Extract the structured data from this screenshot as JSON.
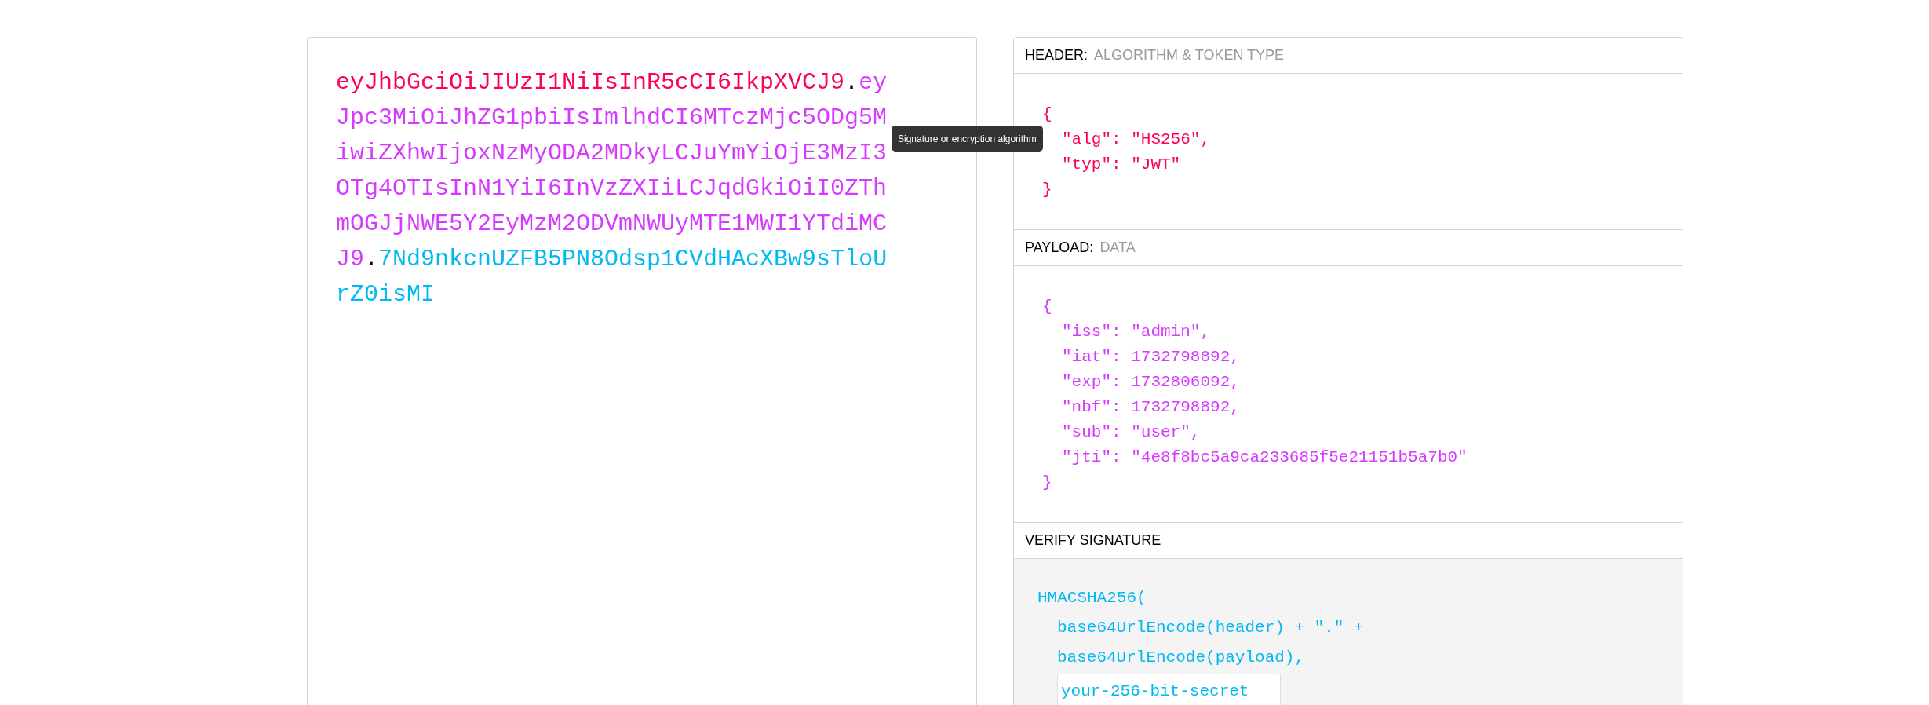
{
  "encoded": {
    "segments": [
      {
        "text": "eyJhbGciOiJIUzI1NiIsInR5cCI6IkpXVCJ9",
        "color": "#fb015b"
      },
      {
        "text": ".",
        "color": "#000000"
      },
      {
        "text": "eyJpc3MiOiJhZG1pbiIsImlhdCI6MTczMjc5ODg5MiwiZXhwIjoxNzMyODA2MDkyLCJuYmYiOjE3MzI3OTg4OTIsInN1YiI6InVzZXIiLCJqdGkiOiI0ZThmOGJjNWE5Y2EyMzM2ODVmNWUyMTE1MWI1YTdiMCJ9",
        "color": "#d63aff"
      },
      {
        "text": ".",
        "color": "#000000"
      },
      {
        "text": "7Nd9nkcnUZFB5PN8Odsp1CVdHAcXBw9sTloUrZ0isMI",
        "color": "#00b9f1"
      }
    ]
  },
  "tooltip": {
    "text": "Signature or encryption algorithm"
  },
  "sections": [
    {
      "kind": "json",
      "label": "HEADER:",
      "sublabel": "ALGORITHM & TOKEN TYPE",
      "color": "#fb015b",
      "open": "{",
      "close": "}",
      "lines": [
        "\"alg\": \"HS256\",",
        "\"typ\": \"JWT\""
      ]
    },
    {
      "kind": "json",
      "label": "PAYLOAD:",
      "sublabel": "DATA",
      "color": "#d63aff",
      "open": "{",
      "close": "}",
      "lines": [
        "\"iss\": \"admin\",",
        "\"iat\": 1732798892,",
        "\"exp\": 1732806092,",
        "\"nbf\": 1732798892,",
        "\"sub\": \"user\",",
        "\"jti\": \"4e8f8bc5a9ca233685f5e21151b5a7b0\""
      ]
    },
    {
      "kind": "verify",
      "label": "VERIFY SIGNATURE",
      "color": "#00b9f1",
      "call": "HMACSHA256(",
      "lines": [
        "base64UrlEncode(header) + \".\" +",
        "base64UrlEncode(payload),"
      ],
      "secret": "your-256-bit-secret"
    }
  ]
}
